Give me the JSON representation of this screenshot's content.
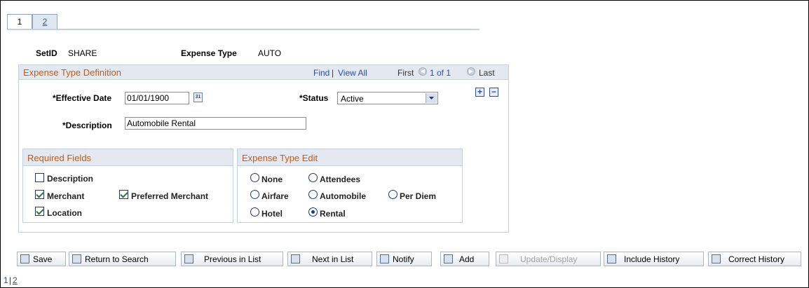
{
  "tabs": [
    {
      "label": "1",
      "active": true
    },
    {
      "label": "2",
      "active": false
    }
  ],
  "header": {
    "setid_label": "SetID",
    "setid_value": "SHARE",
    "expense_type_label": "Expense Type",
    "expense_type_value": "AUTO"
  },
  "definition": {
    "title": "Expense Type Definition",
    "find": "Find",
    "separator": "|",
    "view_all": "View All",
    "first": "First",
    "position": "1 of 1",
    "last": "Last",
    "effective_date_label": "*Effective Date",
    "effective_date_value": "01/01/1900",
    "status_label": "*Status",
    "status_value": "Active",
    "description_label": "*Description",
    "description_value": "Automobile Rental",
    "add_row": "+",
    "delete_row": "−"
  },
  "required_fields": {
    "title": "Required Fields",
    "items": [
      {
        "label": "Description",
        "checked": false
      },
      {
        "label": "Merchant",
        "checked": true
      },
      {
        "label": "Preferred Merchant",
        "checked": true
      },
      {
        "label": "Location",
        "checked": true
      }
    ]
  },
  "expense_type_edit": {
    "title": "Expense Type Edit",
    "options": [
      {
        "label": "None",
        "selected": false
      },
      {
        "label": "Attendees",
        "selected": false
      },
      {
        "label": "Airfare",
        "selected": false
      },
      {
        "label": "Automobile",
        "selected": false
      },
      {
        "label": "Per Diem",
        "selected": false
      },
      {
        "label": "Hotel",
        "selected": false
      },
      {
        "label": "Rental",
        "selected": true
      }
    ]
  },
  "toolbar": {
    "save": "Save",
    "return_to_search": "Return to Search",
    "previous_in_list": "Previous in List",
    "next_in_list": "Next in List",
    "notify": "Notify",
    "add": "Add",
    "update_display": "Update/Display",
    "include_history": "Include History",
    "correct_history": "Correct History"
  },
  "footer": {
    "page1": "1",
    "separator": "|",
    "page2": "2"
  },
  "colors": {
    "group_title": "#c55a11",
    "link": "#2b4f9e",
    "header_bg": "#e4e9f1"
  }
}
